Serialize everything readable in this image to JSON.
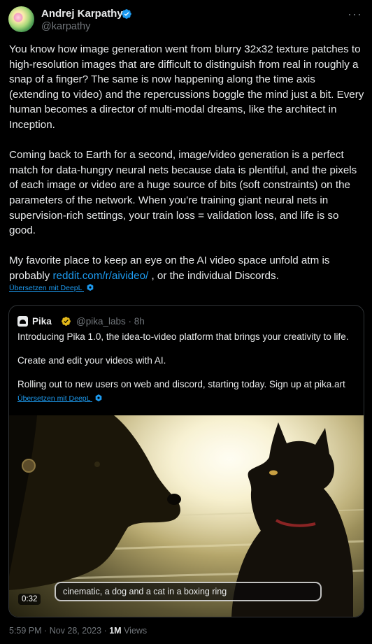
{
  "author": {
    "name": "Andrej Karpathy",
    "handle": "@karpathy",
    "verified_color": "#1d9bf0"
  },
  "more_icon": "more-horizontal-icon",
  "tweet": {
    "paragraphs": [
      "You know how image generation went from blurry 32x32 texture patches to high-resolution images that are difficult to distinguish from real in roughly a snap of a finger? The same is now happening along the time axis (extending to video) and the repercussions boggle the mind just a bit. Every human becomes a director of multi-modal dreams, like the architect in Inception.",
      "Coming back to Earth for a second, image/video generation is a perfect match for data-hungry neural nets because data is plentiful, and the pixels of each image or video are a huge source of bits (soft constraints) on the parameters of the network. When you're training giant neural nets in supervision-rich settings, your train loss = validation loss, and life is so good."
    ],
    "last_paragraph_before": "My favorite place to keep an eye on the AI video space unfold atm is probably ",
    "link_text": "reddit.com/r/aivideo/",
    "last_paragraph_after": " , or the individual Discords.",
    "translate_label": "Übersetzen mit DeepL"
  },
  "quoted": {
    "name": "Pika",
    "handle": "@pika_labs",
    "separator": "·",
    "time": "8h",
    "badge_color": "#e2b719",
    "paragraphs": [
      "Introducing Pika 1.0, the idea-to-video platform that brings your creativity to life.",
      "Create and edit your videos with AI.",
      "Rolling out to new users on web and discord, starting today. Sign up at pika.art"
    ],
    "translate_label": "Übersetzen mit DeepL",
    "video": {
      "duration": "0:32",
      "caption": "cinematic, a dog and a cat in a boxing ring"
    }
  },
  "meta": {
    "time": "5:59 PM",
    "separator": "·",
    "date": "Nov 28, 2023",
    "views_count": "1M",
    "views_label": "Views"
  }
}
